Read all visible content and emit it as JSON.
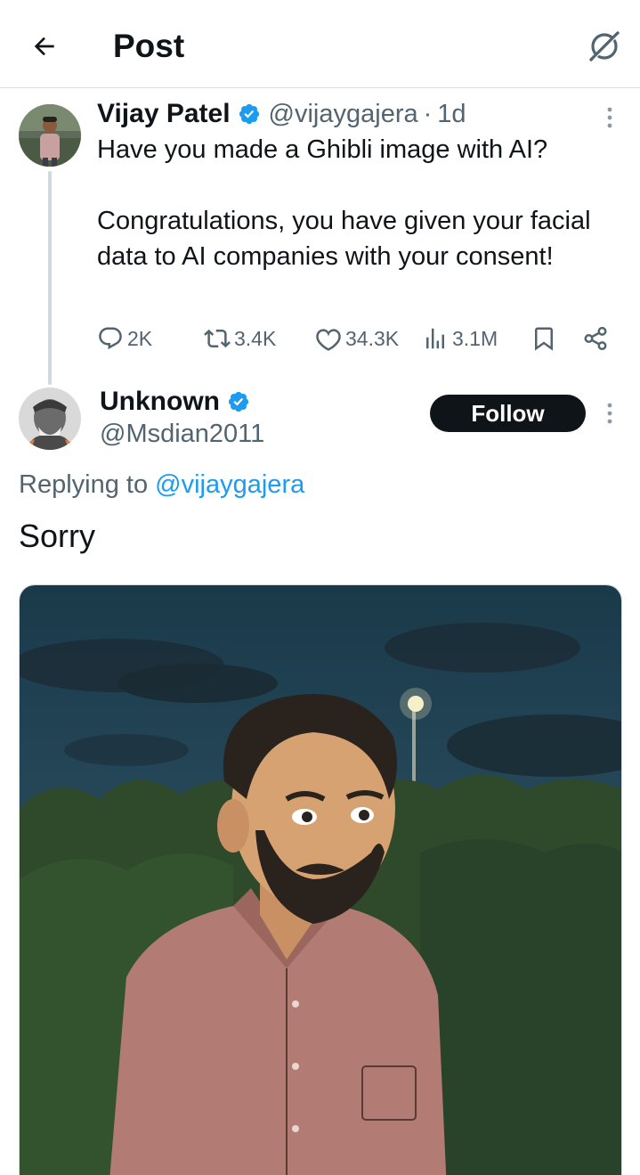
{
  "header": {
    "title": "Post",
    "back_icon": "arrow-left-icon",
    "grok_icon": "grok-icon"
  },
  "parent_tweet": {
    "display_name": "Vijay Patel",
    "handle": "@vijaygajera",
    "separator": "·",
    "time": "1d",
    "text_lines": [
      "Have you made a Ghibli image with AI?",
      "Congratulations, you have given your facial data to AI companies with your consent!"
    ],
    "stats": {
      "replies": "2K",
      "reposts": "3.4K",
      "likes": "34.3K",
      "views": "3.1M"
    }
  },
  "reply_tweet": {
    "display_name": "Unknown",
    "handle": "@Msdian2011",
    "follow_label": "Follow",
    "replying_prefix": "Replying to",
    "replying_to": "@vijaygajera",
    "text": "Sorry"
  },
  "colors": {
    "text": "#0f1419",
    "secondary": "#536471",
    "accent": "#1d9bf0",
    "verified": "#1d9bf0",
    "follow_bg": "#0f1419"
  }
}
